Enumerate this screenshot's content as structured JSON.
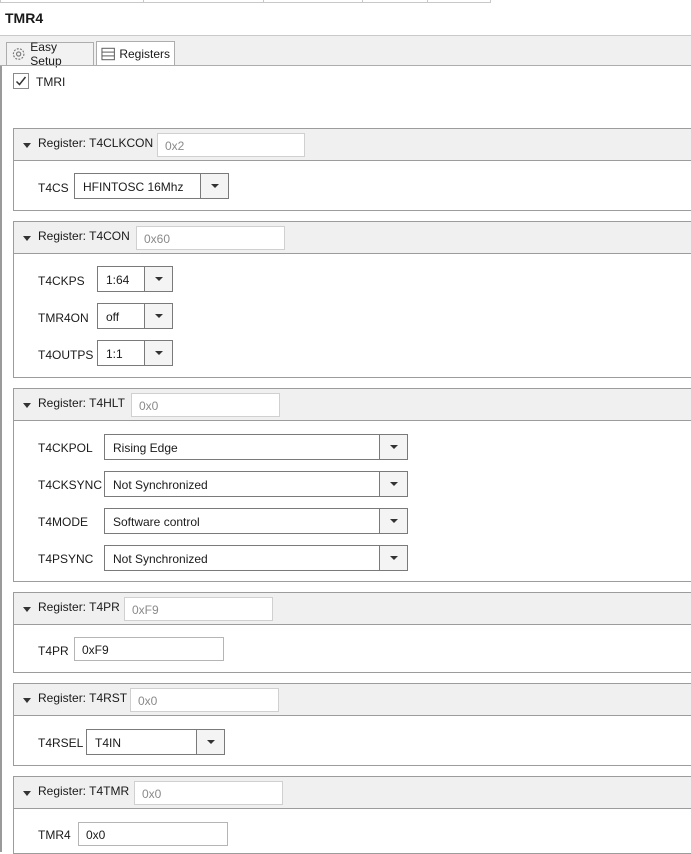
{
  "window": {
    "title": "TMR4"
  },
  "tabs": [
    {
      "label": "Easy Setup",
      "icon": "gear-icon"
    },
    {
      "label": "Registers",
      "icon": "registers-icon",
      "active": true
    }
  ],
  "enable": {
    "label": "TMRI",
    "checked": true
  },
  "registers": {
    "t4clkcon": {
      "header": "Register: T4CLKCON",
      "hex": "0x2",
      "fields": {
        "t4cs": {
          "label": "T4CS",
          "value": "HFINTOSC 16Mhz"
        }
      }
    },
    "t4con": {
      "header": "Register: T4CON",
      "hex": "0x60",
      "fields": {
        "t4ckps": {
          "label": "T4CKPS",
          "value": "1:64"
        },
        "tmr4on": {
          "label": "TMR4ON",
          "value": "off"
        },
        "t4outps": {
          "label": "T4OUTPS",
          "value": "1:1"
        }
      }
    },
    "t4hlt": {
      "header": "Register: T4HLT",
      "hex": "0x0",
      "fields": {
        "t4ckpol": {
          "label": "T4CKPOL",
          "value": "Rising Edge"
        },
        "t4cksync": {
          "label": "T4CKSYNC",
          "value": "Not Synchronized"
        },
        "t4mode": {
          "label": "T4MODE",
          "value": "Software control"
        },
        "t4psync": {
          "label": "T4PSYNC",
          "value": "Not Synchronized"
        }
      }
    },
    "t4pr": {
      "header": "Register: T4PR",
      "hex": "0xF9",
      "fields": {
        "t4pr": {
          "label": "T4PR",
          "value": "0xF9"
        }
      }
    },
    "t4rst": {
      "header": "Register: T4RST",
      "hex": "0x0",
      "fields": {
        "t4rsel": {
          "label": "T4RSEL",
          "value": "T4IN"
        }
      }
    },
    "t4tmr": {
      "header": "Register: T4TMR",
      "hex": "0x0",
      "fields": {
        "tmr4": {
          "label": "TMR4",
          "value": "0x0"
        }
      }
    }
  }
}
